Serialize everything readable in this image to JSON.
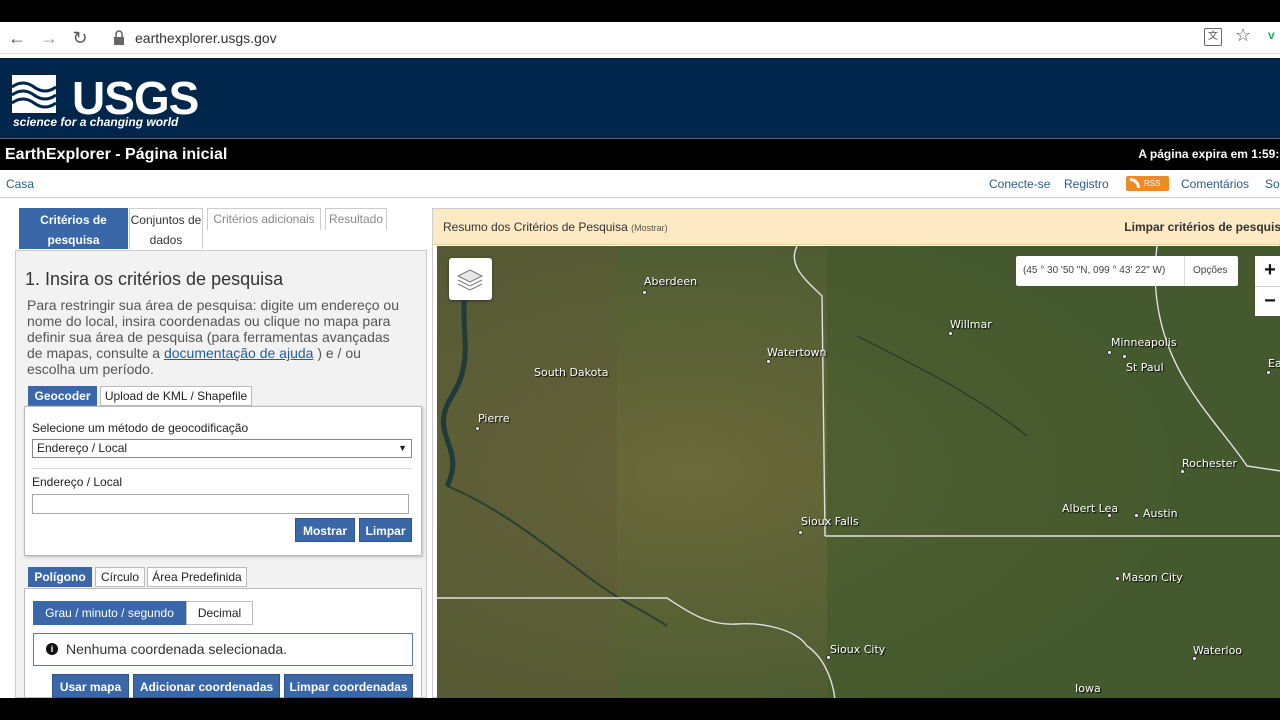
{
  "browser": {
    "url": "earthexplorer.usgs.gov",
    "translate_glyph": "文",
    "star_glyph": "☆",
    "profile_glyph": "v"
  },
  "header": {
    "logo_word": "USGS",
    "logo_tagline": "science for a changing world",
    "page_title": "EarthExplorer - Página inicial",
    "expire_text": "A página expira em 1:59:5"
  },
  "nav": {
    "home": "Casa",
    "links": [
      "Conecte-se",
      "Registro",
      "RSS",
      "Comentários",
      "So"
    ]
  },
  "tabs": {
    "criteria": "Critérios de pesquisa",
    "datasets": "Conjuntos de dados",
    "additional": "Critérios adicionais",
    "results": "Resultado"
  },
  "criteria": {
    "heading": "1. Insira os critérios de pesquisa",
    "desc_before": "Para restringir sua área de pesquisa: digite um endereço ou nome do local, insira coordenadas ou clique no mapa para definir sua área de pesquisa (para ferramentas avançadas de mapas, consulte a ",
    "desc_link": "documentação de ajuda",
    "desc_after": " ) e / ou escolha um período."
  },
  "geocoder": {
    "tab_geocoder": "Geocoder",
    "tab_kml": "Upload de KML / Shapefile",
    "method_label": "Selecione um método de geocodificação",
    "method_value": "Endereço / Local",
    "address_label": "Endereço / Local",
    "address_value": "",
    "show_button": "Mostrar",
    "clear_button": "Limpar"
  },
  "shape": {
    "tab_polygon": "Polígono",
    "tab_circle": "Círculo",
    "tab_predefined": "Área Predefinida",
    "fmt_dms": "Grau / minuto / segundo",
    "fmt_decimal": "Decimal",
    "no_coord": "Nenhuma coordenada selecionada.",
    "use_map": "Usar mapa",
    "add_coords": "Adicionar coordenadas",
    "clear_coords": "Limpar coordenadas"
  },
  "map": {
    "summary_title": "Resumo dos Critérios de Pesquisa",
    "summary_show": "(Mostrar)",
    "clear_criteria": "Limpar critérios de pesquis",
    "coord_readout": "(45 ° 30 '50 \"N, 099 ° 43' 22\" W)",
    "options": "Opções",
    "zoom_in": "+",
    "zoom_out": "−",
    "cities": [
      {
        "name": "Aberdeen"
      },
      {
        "name": "Willmar"
      },
      {
        "name": "Watertown"
      },
      {
        "name": "Minneapolis"
      },
      {
        "name": "St Paul"
      },
      {
        "name": "Ea"
      },
      {
        "name": "South Dakota"
      },
      {
        "name": "Pierre"
      },
      {
        "name": "Rochester"
      },
      {
        "name": "Albert Lea"
      },
      {
        "name": "Austin"
      },
      {
        "name": "Sioux Falls"
      },
      {
        "name": "Mason City"
      },
      {
        "name": "Sioux City"
      },
      {
        "name": "Waterloo"
      },
      {
        "name": "Iowa"
      }
    ]
  }
}
